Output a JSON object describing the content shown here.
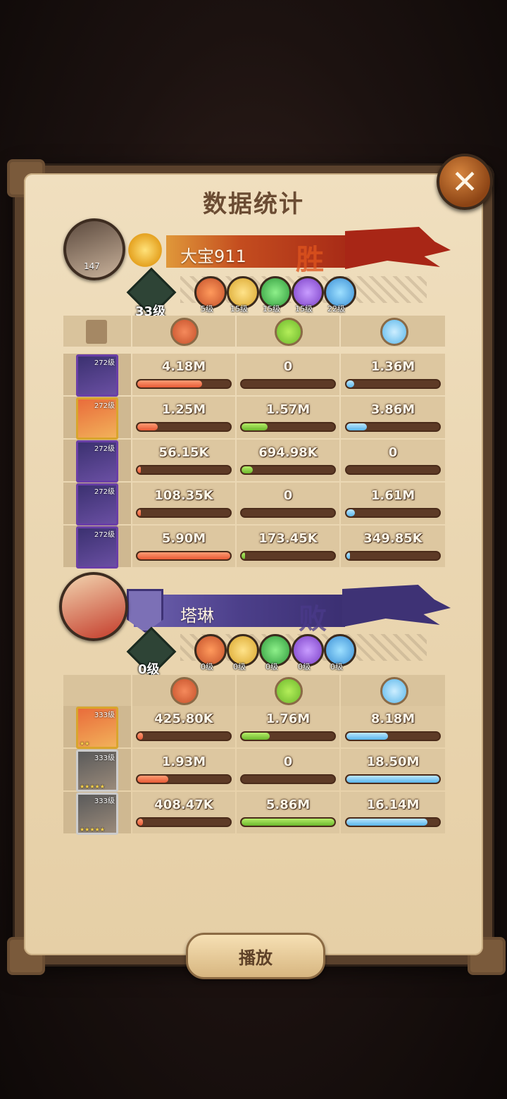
{
  "title": "数据统计",
  "close_label": "✕",
  "play_label": "播放",
  "winner": {
    "name": "大宝911",
    "result": "胜",
    "avatar_level": "147",
    "tree_level": "33级",
    "factions": [
      "5级",
      "15级",
      "15级",
      "15级",
      "22级"
    ],
    "heroes": [
      {
        "level": "272级",
        "damage": "4.18M",
        "damage_pct": 0.7,
        "heal": "0",
        "heal_pct": 0,
        "def": "1.36M",
        "def_pct": 0.08,
        "style": "purple"
      },
      {
        "level": "272级",
        "damage": "1.25M",
        "damage_pct": 0.22,
        "heal": "1.57M",
        "heal_pct": 0.28,
        "def": "3.86M",
        "def_pct": 0.22,
        "style": "gold"
      },
      {
        "level": "272级",
        "damage": "56.15K",
        "damage_pct": 0.02,
        "heal": "694.98K",
        "heal_pct": 0.12,
        "def": "0",
        "def_pct": 0,
        "style": "purple"
      },
      {
        "level": "272级",
        "damage": "108.35K",
        "damage_pct": 0.03,
        "heal": "0",
        "heal_pct": 0,
        "def": "1.61M",
        "def_pct": 0.09,
        "style": "purple"
      },
      {
        "level": "272级",
        "damage": "5.90M",
        "damage_pct": 1.0,
        "heal": "173.45K",
        "heal_pct": 0.04,
        "def": "349.85K",
        "def_pct": 0.02,
        "style": "purple"
      }
    ]
  },
  "loser": {
    "name": "塔琳",
    "result": "败",
    "tree_level": "0级",
    "factions": [
      "0级",
      "0级",
      "0级",
      "0级",
      "0级"
    ],
    "heroes": [
      {
        "level": "333级",
        "stars": "★★",
        "damage": "425.80K",
        "damage_pct": 0.06,
        "heal": "1.76M",
        "heal_pct": 0.3,
        "def": "8.18M",
        "def_pct": 0.45,
        "style": "gold"
      },
      {
        "level": "333级",
        "stars": "★★★★★",
        "damage": "1.93M",
        "damage_pct": 0.33,
        "heal": "0",
        "heal_pct": 0,
        "def": "18.50M",
        "def_pct": 1.0,
        "style": "grey"
      },
      {
        "level": "333级",
        "stars": "★★★★★",
        "damage": "408.47K",
        "damage_pct": 0.06,
        "heal": "5.86M",
        "heal_pct": 1.0,
        "def": "16.14M",
        "def_pct": 0.87,
        "style": "grey"
      }
    ]
  },
  "colors": {
    "damage": "#e65a36",
    "heal": "#6cb82c",
    "defense": "#59b6ea",
    "faction": [
      "#c4502a",
      "#d9a52c",
      "#2f9a3c",
      "#7a3ec6",
      "#3a8fd6"
    ]
  },
  "icons": {
    "damage": "fist-icon",
    "heal": "heal-icon",
    "defense": "shield-icon",
    "record": "scroll-icon"
  }
}
